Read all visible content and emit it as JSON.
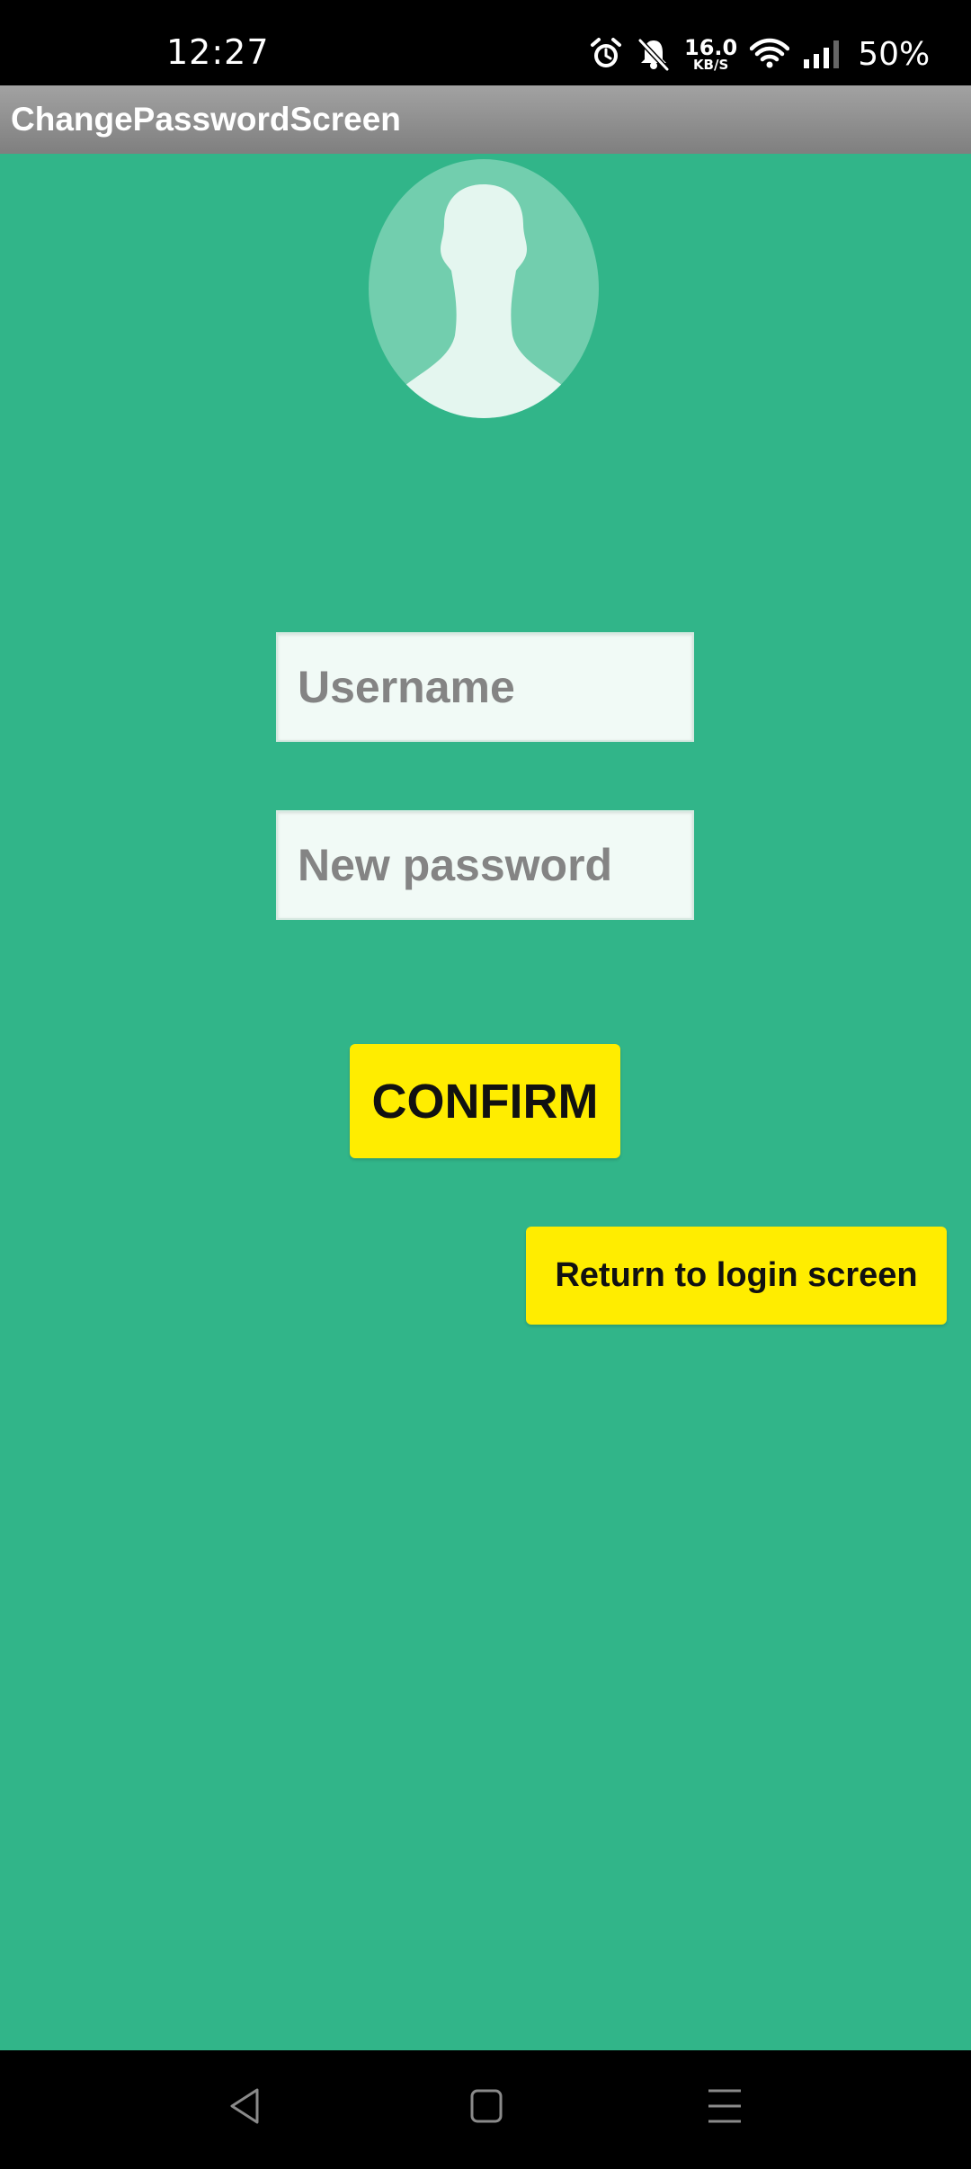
{
  "status_bar": {
    "time": "12:27",
    "net_speed_value": "16.0",
    "net_speed_unit": "KB/S",
    "battery": "50%",
    "icons": [
      "alarm-icon",
      "bell-muted-icon",
      "wifi-icon",
      "signal-icon"
    ]
  },
  "app": {
    "title": "ChangePasswordScreen",
    "background_color": "#31b589",
    "accent_color": "#ffed00"
  },
  "form": {
    "username_placeholder": "Username",
    "username_value": "",
    "password_placeholder": "New password",
    "password_value": "",
    "confirm_label": "CONFIRM",
    "return_label": "Return to login screen"
  },
  "nav_bar": {
    "icons": [
      "back-icon",
      "home-icon",
      "menu-icon"
    ]
  }
}
